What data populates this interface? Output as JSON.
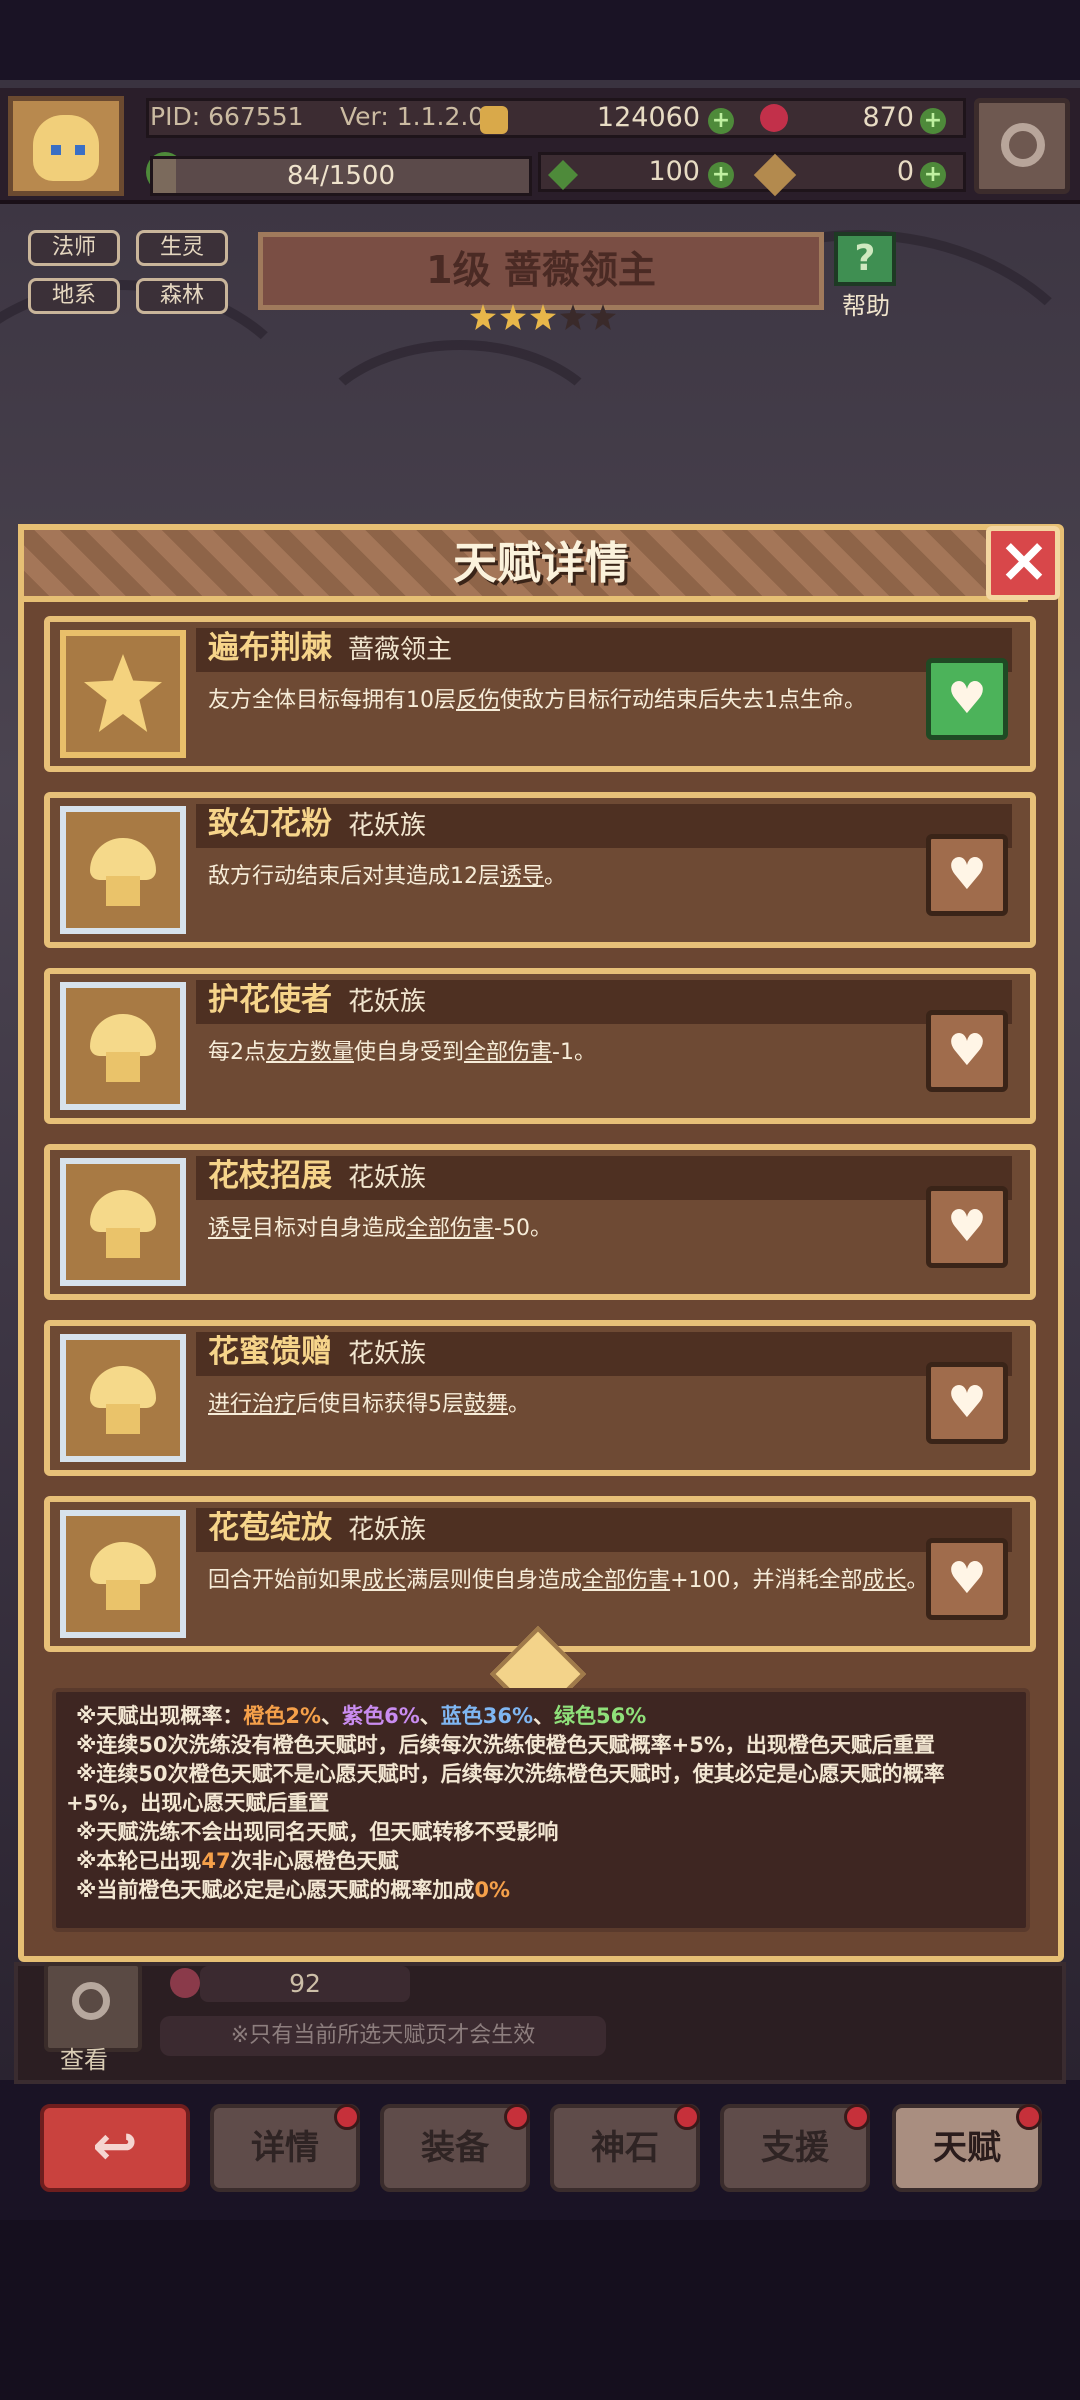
{
  "top": {
    "pid": "PID: 667551",
    "ver": "Ver: 1.1.2.0",
    "gold": "124060",
    "gems": "870",
    "xp": "84/1500",
    "clover": "100",
    "scroll": "0"
  },
  "tags": [
    "法师",
    "生灵",
    "地系",
    "森林"
  ],
  "banner": {
    "title": "1级  蔷薇领主",
    "help_label": "帮助",
    "stars_filled": 3,
    "stars_total": 5
  },
  "dialog": {
    "title": "天赋详情",
    "talents": [
      {
        "name": "遍布荆棘",
        "tribe": "蔷薇领主",
        "desc_parts": [
          "友方全体目标每拥有10层",
          "反伤",
          "使敌方目标行动结束后失去1点生命。"
        ],
        "selected": true
      },
      {
        "name": "致幻花粉",
        "tribe": "花妖族",
        "desc_parts": [
          "敌方行动结束后对其造成12层",
          "诱导",
          "。"
        ],
        "selected": false
      },
      {
        "name": "护花使者",
        "tribe": "花妖族",
        "desc_parts": [
          "每2点",
          "友方数量",
          "使自身受到",
          "全部伤害",
          "-1。"
        ],
        "selected": false
      },
      {
        "name": "花枝招展",
        "tribe": "花妖族",
        "desc_parts": [
          "诱导",
          "目标对自身造成",
          "全部伤害",
          "-50。"
        ],
        "selected": false
      },
      {
        "name": "花蜜馈赠",
        "tribe": "花妖族",
        "desc_parts": [
          "进行治疗",
          "后使目标获得5层",
          "鼓舞",
          "。"
        ],
        "selected": false
      },
      {
        "name": "花苞绽放",
        "tribe": "花妖族",
        "desc_parts": [
          "回合开始前如果",
          "成长",
          "满层则使自身造成",
          "全部伤害",
          "+100，并消耗全部",
          "成长",
          "。"
        ],
        "selected": false
      }
    ],
    "info": {
      "rate_prefix": "※天赋出现概率：",
      "rate_orange": "橙色2%",
      "rate_purple": "紫色6%",
      "rate_blue": "蓝色36%",
      "rate_green": "绿色56%",
      "sep": "、",
      "line2": "※连续50次洗练没有橙色天赋时，后续每次洗练使橙色天赋概率+5%，出现橙色天赋后重置",
      "line3a": "※连续50次橙色天赋不是心愿天赋时，后续每次洗练橙色天赋时，使其必定是心愿天赋的概率",
      "line3b": "+5%，出现心愿天赋后重置",
      "line4": "※天赋洗练不会出现同名天赋，但天赋转移不受影响",
      "line5_pre": "※本轮已出现",
      "line5_num": "47",
      "line5_post": "次非心愿橙色天赋",
      "line6_pre": "※当前橙色天赋必定是心愿天赋的概率加成",
      "line6_num": "0%"
    }
  },
  "lower": {
    "count": "92",
    "view_label": "查看",
    "note": "※只有当前所选天赋页才会生效"
  },
  "tabs": [
    "详情",
    "装备",
    "神石",
    "支援",
    "天赋"
  ],
  "colors": {
    "orange": "#f5a04a",
    "purple": "#c98cf0",
    "blue": "#7fb6f2",
    "green": "#8fe07a",
    "highlight": "#f5a04a"
  }
}
